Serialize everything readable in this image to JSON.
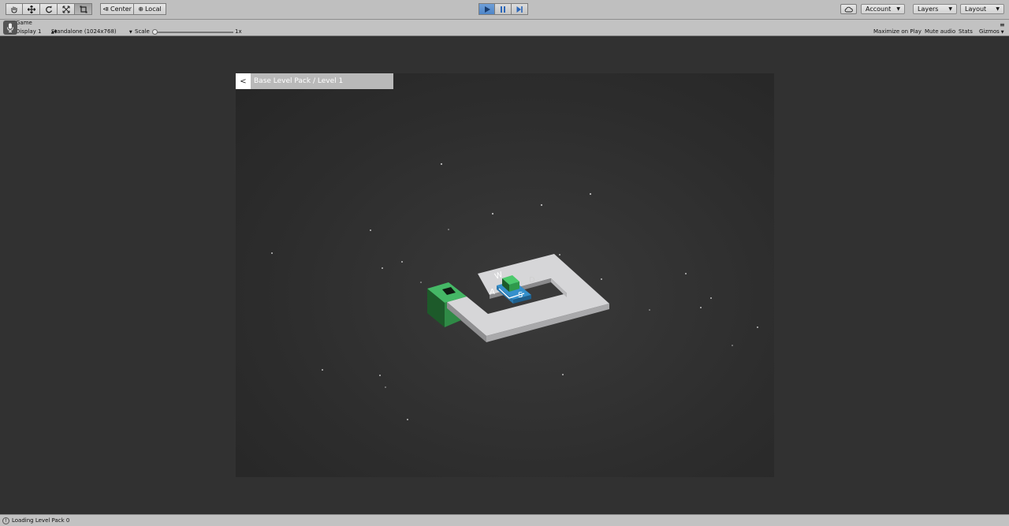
{
  "toolbar": {
    "tools": [
      "hand-tool-icon",
      "move-tool-icon",
      "rotate-tool-icon",
      "scale-tool-icon",
      "rect-tool-icon"
    ],
    "pivot_mode": "Center",
    "pivot_rotation": "Local",
    "account_label": "Account",
    "layers_label": "Layers",
    "layout_label": "Layout"
  },
  "game_view": {
    "tab_label": "Game",
    "display_label": "Display 1",
    "resolution_label": "Standalone (1024x768)",
    "scale_label": "Scale",
    "scale_value_label": "1x",
    "scale_value": 1,
    "maximize_label": "Maximize on Play",
    "mute_label": "Mute audio",
    "stats_label": "Stats",
    "gizmos_label": "Gizmos"
  },
  "game": {
    "back_label": "<",
    "level_title": "Base Level Pack / Level 1",
    "key_w": "W",
    "key_a": "A",
    "key_s": "S",
    "key_d": "D",
    "colors": {
      "floor": "#d4d4d6",
      "goal": "#3fae5e",
      "player": "#35b05a",
      "spawn": "#2f86c2"
    }
  },
  "status": {
    "message": "Loading Level Pack 0"
  }
}
